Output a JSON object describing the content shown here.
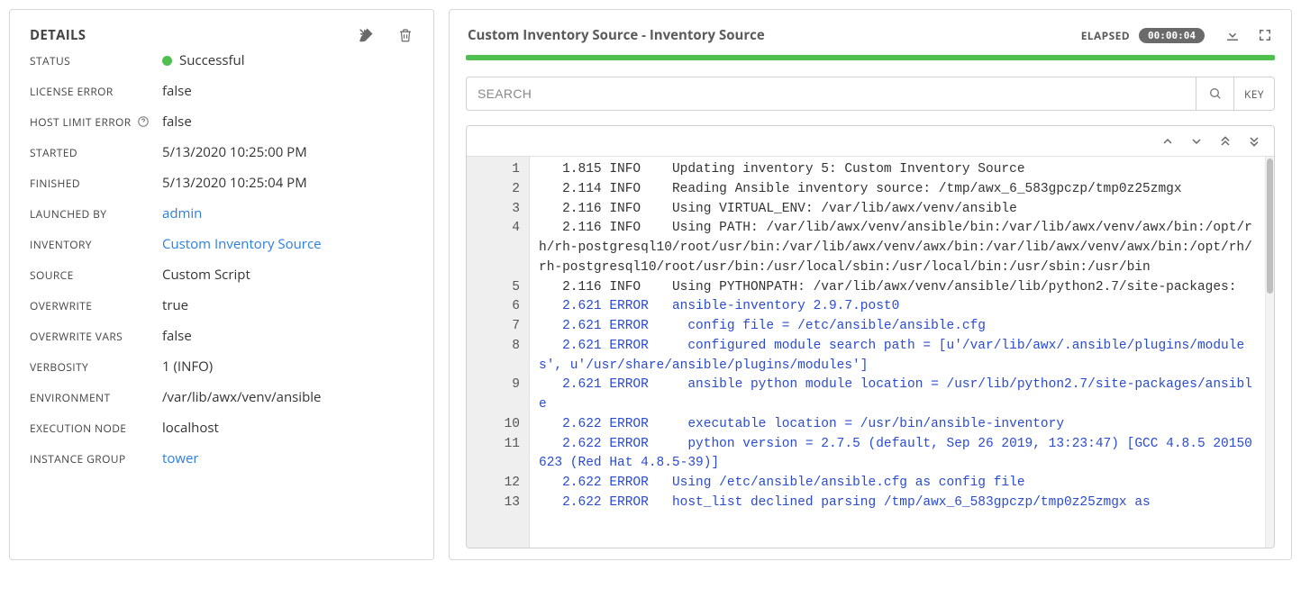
{
  "details": {
    "title": "DETAILS",
    "status_label": "STATUS",
    "status_text": "Successful",
    "license_error_label": "LICENSE ERROR",
    "license_error": "false",
    "host_limit_label": "HOST LIMIT ERROR",
    "host_limit_error": "false",
    "started_label": "STARTED",
    "started": "5/13/2020 10:25:00 PM",
    "finished_label": "FINISHED",
    "finished": "5/13/2020 10:25:04 PM",
    "launched_by_label": "LAUNCHED BY",
    "launched_by": "admin",
    "inventory_label": "INVENTORY",
    "inventory": "Custom Inventory Source",
    "source_label": "SOURCE",
    "source": "Custom Script",
    "overwrite_label": "OVERWRITE",
    "overwrite": "true",
    "overwrite_vars_label": "OVERWRITE VARS",
    "overwrite_vars": "false",
    "verbosity_label": "VERBOSITY",
    "verbosity": "1 (INFO)",
    "environment_label": "ENVIRONMENT",
    "environment": "/var/lib/awx/venv/ansible",
    "execution_node_label": "EXECUTION NODE",
    "execution_node": "localhost",
    "instance_group_label": "INSTANCE GROUP",
    "instance_group": "tower"
  },
  "output": {
    "title": "Custom Inventory Source - Inventory Source",
    "elapsed_label": "ELAPSED",
    "elapsed": "00:00:04",
    "search_placeholder": "SEARCH",
    "key_label": "KEY",
    "log": [
      {
        "n": "1",
        "ts": "1.815",
        "lvl": "INFO",
        "msg": "Updating inventory 5: Custom Inventory Source",
        "link": false
      },
      {
        "n": "2",
        "ts": "2.114",
        "lvl": "INFO",
        "msg": "Reading Ansible inventory source: /tmp/awx_6_583gpczp/tmp0z25zmgx",
        "link": false
      },
      {
        "n": "3",
        "ts": "2.116",
        "lvl": "INFO",
        "msg": "Using VIRTUAL_ENV: /var/lib/awx/venv/ansible",
        "link": false
      },
      {
        "n": "4",
        "ts": "2.116",
        "lvl": "INFO",
        "msg": "Using PATH: /var/lib/awx/venv/ansible/bin:/var/lib/awx/venv/awx/bin:/opt/rh/rh-postgresql10/root/usr/bin:/var/lib/awx/venv/awx/bin:/var/lib/awx/venv/awx/bin:/opt/rh/rh-postgresql10/root/usr/bin:/usr/local/sbin:/usr/local/bin:/usr/sbin:/usr/bin",
        "link": false
      },
      {
        "n": "5",
        "ts": "2.116",
        "lvl": "INFO",
        "msg": "Using PYTHONPATH: /var/lib/awx/venv/ansible/lib/python2.7/site-packages:",
        "link": false
      },
      {
        "n": "6",
        "ts": "2.621",
        "lvl": "ERROR",
        "msg": "ansible-inventory 2.9.7.post0",
        "link": true
      },
      {
        "n": "7",
        "ts": "2.621",
        "lvl": "ERROR",
        "msg": "  config file = /etc/ansible/ansible.cfg",
        "link": true
      },
      {
        "n": "8",
        "ts": "2.621",
        "lvl": "ERROR",
        "msg": "  configured module search path = [u'/var/lib/awx/.ansible/plugins/modules', u'/usr/share/ansible/plugins/modules']",
        "link": true
      },
      {
        "n": "9",
        "ts": "2.621",
        "lvl": "ERROR",
        "msg": "  ansible python module location = /usr/lib/python2.7/site-packages/ansible",
        "link": true
      },
      {
        "n": "10",
        "ts": "2.622",
        "lvl": "ERROR",
        "msg": "  executable location = /usr/bin/ansible-inventory",
        "link": true
      },
      {
        "n": "11",
        "ts": "2.622",
        "lvl": "ERROR",
        "msg": "  python version = 2.7.5 (default, Sep 26 2019, 13:23:47) [GCC 4.8.5 20150623 (Red Hat 4.8.5-39)]",
        "link": true
      },
      {
        "n": "12",
        "ts": "2.622",
        "lvl": "ERROR",
        "msg": "Using /etc/ansible/ansible.cfg as config file",
        "link": true
      },
      {
        "n": "13",
        "ts": "2.622",
        "lvl": "ERROR",
        "msg": "host_list declined parsing /tmp/awx_6_583gpczp/tmp0z25zmgx as",
        "link": true
      }
    ]
  }
}
